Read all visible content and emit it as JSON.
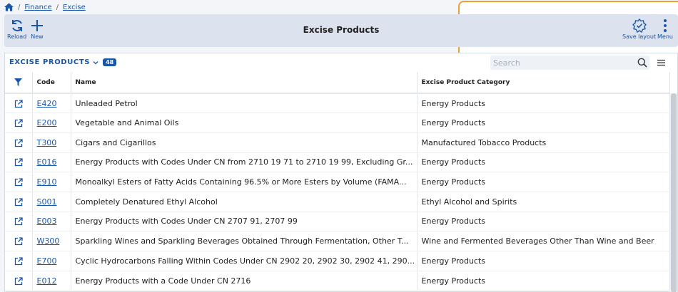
{
  "breadcrumb": {
    "items": [
      "Finance",
      "Excise"
    ]
  },
  "toolbar": {
    "title": "Excise Products",
    "reload_label": "Reload",
    "new_label": "New",
    "save_layout_label": "Save layout",
    "menu_label": "Menu"
  },
  "list": {
    "title": "EXCISE PRODUCTS",
    "count": "48",
    "search_placeholder": "Search",
    "columns": [
      "Code",
      "Name",
      "Excise Product Category"
    ],
    "rows": [
      {
        "code": "E420",
        "name": "Unleaded Petrol",
        "category": "Energy Products"
      },
      {
        "code": "E200",
        "name": "Vegetable and Animal Oils",
        "category": "Energy Products"
      },
      {
        "code": "T300",
        "name": "Cigars and Cigarillos",
        "category": "Manufactured Tobacco Products"
      },
      {
        "code": "E016",
        "name": "Energy Products with Codes Under CN from 2710 19 71 to 2710 19 99, Excluding Gr...",
        "category": "Energy Products"
      },
      {
        "code": "E910",
        "name": "Monoalkyl Esters of Fatty Acids Containing 96.5% or More Esters by Volume (FAMA...",
        "category": "Energy Products"
      },
      {
        "code": "S001",
        "name": "Completely Denatured Ethyl Alcohol",
        "category": "Ethyl Alcohol and Spirits"
      },
      {
        "code": "E003",
        "name": "Energy Products with Codes Under CN 2707 91, 2707 99",
        "category": "Energy Products"
      },
      {
        "code": "W300",
        "name": "Sparkling Wines and Sparkling Beverages Obtained Through Fermentation, Other T...",
        "category": "Wine and Fermented Beverages Other Than Wine and Beer"
      },
      {
        "code": "E700",
        "name": "Cyclic Hydrocarbons Falling Within Codes Under CN 2902 20, 2902 30, 2902 41, 290...",
        "category": "Energy Products"
      },
      {
        "code": "E012",
        "name": "Energy Products with a Code Under CN 2716",
        "category": "Energy Products"
      }
    ]
  },
  "colors": {
    "accent": "#1a56a8",
    "toolbar_bg": "#dce3ee",
    "highlight_border": "#f0a030"
  }
}
